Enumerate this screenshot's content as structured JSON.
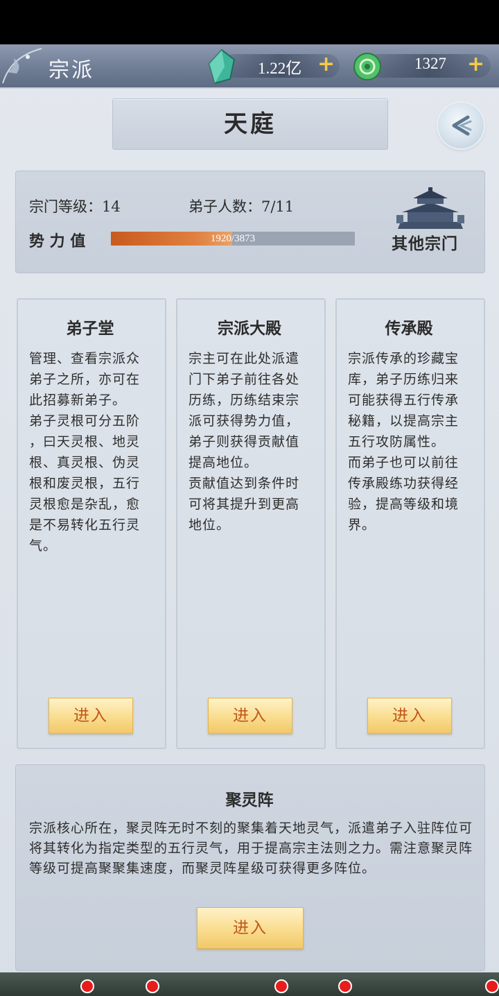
{
  "header": {
    "title": "宗派",
    "resources": [
      {
        "name": "spirit-crystal",
        "value": "1.22亿",
        "plus": "+"
      },
      {
        "name": "jade-token",
        "value": "1327",
        "plus": "+"
      }
    ]
  },
  "sect": {
    "name": "天庭",
    "level_label": "宗门等级：14",
    "disciples_label": "弟子人数：7/11",
    "power_label": "势 力 值",
    "power_current": "1920",
    "power_max": "/3873",
    "power_fraction": 0.496,
    "other_sects_label": "其他宗门"
  },
  "cards": [
    {
      "title": "弟子堂",
      "desc": "管理、查看宗派众\n弟子之所，亦可在\n此招募新弟子。\n弟子灵根可分五阶\n，曰天灵根、地灵\n根、真灵根、伪灵\n根和废灵根，五行\n灵根愈是杂乱，愈\n是不易转化五行灵\n气。",
      "enter": "进入"
    },
    {
      "title": "宗派大殿",
      "desc": "宗主可在此处派遣\n门下弟子前往各处\n历练，历练结束宗\n派可获得势力值，\n弟子则获得贡献值\n提高地位。\n贡献值达到条件时\n可将其提升到更高\n地位。",
      "enter": "进入"
    },
    {
      "title": "传承殿",
      "desc": "宗派传承的珍藏宝\n库，弟子历练归来\n可能获得五行传承\n秘籍，以提高宗主\n五行攻防属性。\n而弟子也可以前往\n传承殿练功获得经\n验，提高等级和境\n界。",
      "enter": "进入"
    }
  ],
  "gathering": {
    "title": "聚灵阵",
    "desc": "宗派核心所在，聚灵阵无时不刻的聚集着天地灵气，派遣弟子入驻阵位可将其转化为指定类型的五行灵气，用于提高宗主法则之力。需注意聚灵阵等级可提高聚聚集速度，而聚灵阵星级可获得更多阵位。",
    "enter": "进入"
  },
  "colors": {
    "accent_orange": "#c0561a",
    "power_fill": "#d86a2a",
    "plus_gold": "#f7c94a",
    "notify_red": "#e81c1c"
  }
}
